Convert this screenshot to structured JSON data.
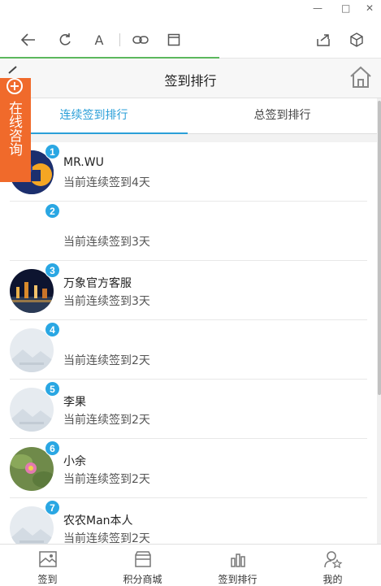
{
  "window": {
    "minimize": "—",
    "maximize": "□",
    "close": "✕"
  },
  "browser": {
    "back_icon": "arrow-left-icon",
    "refresh_icon": "refresh-icon",
    "font_icon": "A",
    "link_icon": "link-icon",
    "window_icon": "window-icon",
    "share_icon": "share-icon",
    "cube_icon": "cube-icon",
    "progress_color": "#5bb85d"
  },
  "header": {
    "title": "签到排行",
    "home_icon": "home-icon"
  },
  "tabs": [
    {
      "label": "连续签到排行",
      "active": true
    },
    {
      "label": "总签到排行",
      "active": false
    }
  ],
  "consult": {
    "text": "在线咨询",
    "plus": "+"
  },
  "accent": "#2a9fd8",
  "list": [
    {
      "rank": "1",
      "name": "MR.WU",
      "status": "当前连续签到4天",
      "avatar": "logo"
    },
    {
      "rank": "2",
      "name": "",
      "status": "当前连续签到3天",
      "avatar": "none"
    },
    {
      "rank": "3",
      "name": "万象官方客服",
      "status": "当前连续签到3天",
      "avatar": "night-city"
    },
    {
      "rank": "4",
      "name": "",
      "status": "当前连续签到2天",
      "avatar": "placeholder"
    },
    {
      "rank": "5",
      "name": "李果",
      "status": "当前连续签到2天",
      "avatar": "placeholder"
    },
    {
      "rank": "6",
      "name": "小余",
      "status": "当前连续签到2天",
      "avatar": "flower"
    },
    {
      "rank": "7",
      "name": "农农Man本人",
      "status": "当前连续签到2天",
      "avatar": "placeholder"
    }
  ],
  "bottom_nav": [
    {
      "label": "签到",
      "icon": "image-icon"
    },
    {
      "label": "积分商城",
      "icon": "shop-icon"
    },
    {
      "label": "签到排行",
      "icon": "bar-chart-icon"
    },
    {
      "label": "我的",
      "icon": "user-star-icon"
    }
  ]
}
